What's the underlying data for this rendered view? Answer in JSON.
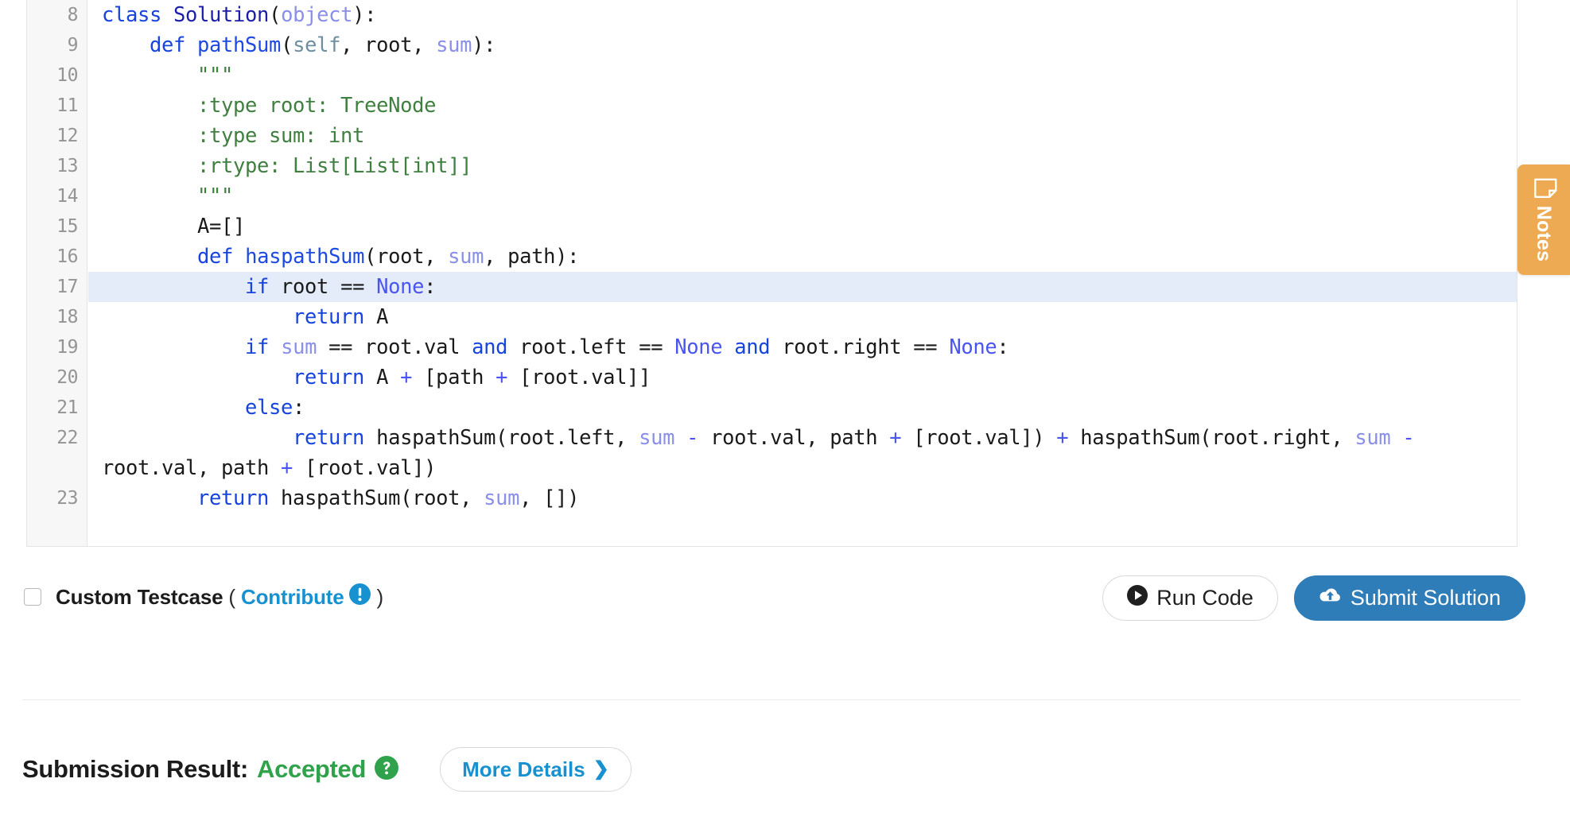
{
  "editor": {
    "first_line_number": 8,
    "active_line_number": 17,
    "line_numbers": [
      "8",
      "9",
      "10",
      "11",
      "12",
      "13",
      "14",
      "15",
      "16",
      "17",
      "18",
      "19",
      "20",
      "21",
      "22",
      "23"
    ],
    "language": "python",
    "lines": [
      {
        "n": "8",
        "text": "class Solution(object):"
      },
      {
        "n": "9",
        "text": "    def pathSum(self, root, sum):"
      },
      {
        "n": "10",
        "text": "        \"\"\""
      },
      {
        "n": "11",
        "text": "        :type root: TreeNode"
      },
      {
        "n": "12",
        "text": "        :type sum: int"
      },
      {
        "n": "13",
        "text": "        :rtype: List[List[int]]"
      },
      {
        "n": "14",
        "text": "        \"\"\""
      },
      {
        "n": "15",
        "text": "        A=[]"
      },
      {
        "n": "16",
        "text": "        def haspathSum(root, sum, path):"
      },
      {
        "n": "17",
        "text": "            if root == None:"
      },
      {
        "n": "18",
        "text": "                return A"
      },
      {
        "n": "19",
        "text": "            if sum == root.val and root.left == None and root.right == None:"
      },
      {
        "n": "20",
        "text": "                return A + [path + [root.val]]"
      },
      {
        "n": "21",
        "text": "            else:"
      },
      {
        "n": "22",
        "text": "                return haspathSum(root.left, sum - root.val, path + [root.val]) + haspathSum(root.right, sum - root.val, path + [root.val])"
      },
      {
        "n": "23",
        "text": "        return haspathSum(root, sum, [])"
      }
    ]
  },
  "notes_tab": {
    "label": "Notes",
    "icon": "note-icon",
    "color": "#eeaa53"
  },
  "action_bar": {
    "custom_testcase_label": "Custom Testcase",
    "open_paren": "(",
    "close_paren": ")",
    "contribute_label": "Contribute",
    "contribute_icon": "info-exclamation-icon",
    "checkbox_checked": false,
    "run_label": "Run Code",
    "run_icon": "play-icon",
    "submit_label": "Submit Solution",
    "submit_icon": "cloud-upload-icon",
    "submit_color": "#2e7cb8",
    "contribute_color": "#1791cf"
  },
  "result": {
    "label": "Submission Result:",
    "status": "Accepted",
    "status_color": "#31a24c",
    "help_icon": "question-circle-icon",
    "more_details_label": "More Details",
    "more_details_icon": "chevron-right-icon",
    "more_details_color": "#1791cf"
  }
}
